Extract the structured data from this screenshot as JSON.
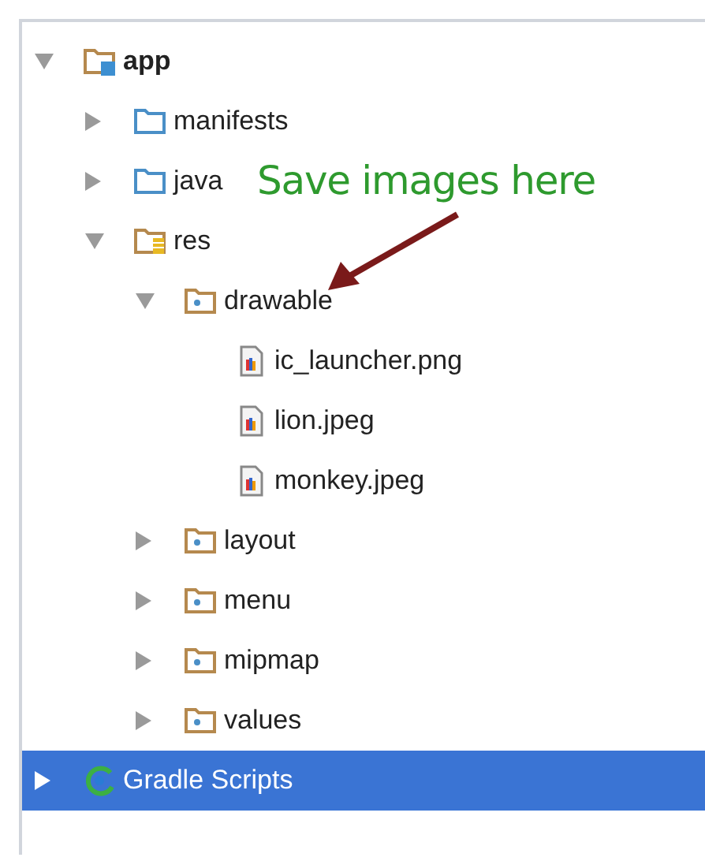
{
  "project_tree": [
    {
      "label": "app",
      "kind": "module",
      "expanded": true,
      "selected": false,
      "children": [
        {
          "label": "manifests",
          "kind": "source-folder",
          "expanded": false,
          "selected": false
        },
        {
          "label": "java",
          "kind": "source-folder",
          "expanded": false,
          "selected": false
        },
        {
          "label": "res",
          "kind": "resources",
          "expanded": true,
          "selected": false,
          "children": [
            {
              "label": "drawable",
              "kind": "folder",
              "expanded": true,
              "selected": false,
              "children": [
                {
                  "label": "ic_launcher.png",
                  "kind": "image-file",
                  "selected": false
                },
                {
                  "label": "lion.jpeg",
                  "kind": "image-file",
                  "selected": false
                },
                {
                  "label": "monkey.jpeg",
                  "kind": "image-file",
                  "selected": false
                }
              ]
            },
            {
              "label": "layout",
              "kind": "folder",
              "expanded": false,
              "selected": false
            },
            {
              "label": "menu",
              "kind": "folder",
              "expanded": false,
              "selected": false
            },
            {
              "label": "mipmap",
              "kind": "folder",
              "expanded": false,
              "selected": false
            },
            {
              "label": "values",
              "kind": "folder",
              "expanded": false,
              "selected": false
            }
          ]
        }
      ]
    },
    {
      "label": "Gradle Scripts",
      "kind": "gradle",
      "expanded": false,
      "selected": true
    }
  ],
  "annotation": {
    "text": "Save images here"
  }
}
